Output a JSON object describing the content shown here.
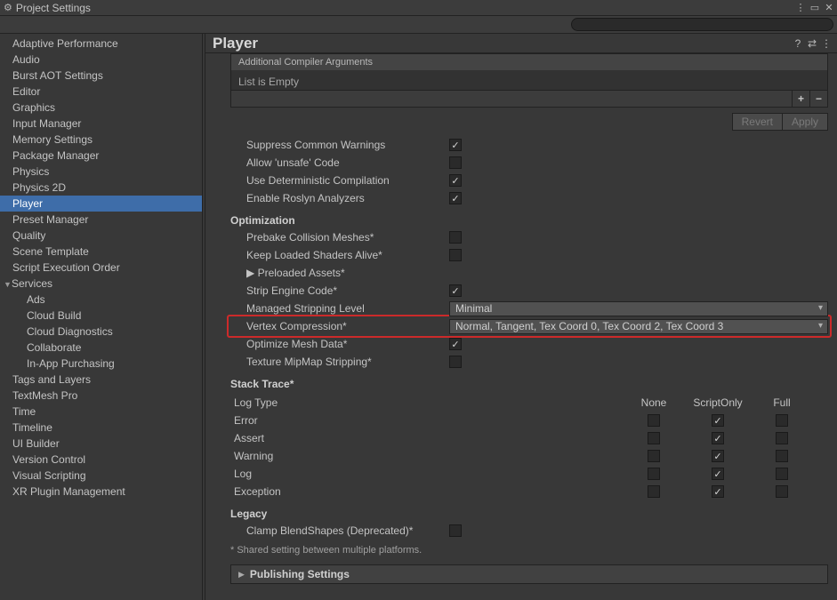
{
  "window": {
    "title": "Project Settings"
  },
  "page": {
    "title": "Player"
  },
  "sidebar": {
    "items": [
      {
        "label": "Adaptive Performance"
      },
      {
        "label": "Audio"
      },
      {
        "label": "Burst AOT Settings"
      },
      {
        "label": "Editor"
      },
      {
        "label": "Graphics"
      },
      {
        "label": "Input Manager"
      },
      {
        "label": "Memory Settings"
      },
      {
        "label": "Package Manager"
      },
      {
        "label": "Physics"
      },
      {
        "label": "Physics 2D"
      },
      {
        "label": "Player",
        "selected": true
      },
      {
        "label": "Preset Manager"
      },
      {
        "label": "Quality"
      },
      {
        "label": "Scene Template"
      },
      {
        "label": "Script Execution Order"
      },
      {
        "label": "Services",
        "expandable": true
      },
      {
        "label": "Ads",
        "sub": true
      },
      {
        "label": "Cloud Build",
        "sub": true
      },
      {
        "label": "Cloud Diagnostics",
        "sub": true
      },
      {
        "label": "Collaborate",
        "sub": true
      },
      {
        "label": "In-App Purchasing",
        "sub": true
      },
      {
        "label": "Tags and Layers"
      },
      {
        "label": "TextMesh Pro"
      },
      {
        "label": "Time"
      },
      {
        "label": "Timeline"
      },
      {
        "label": "UI Builder"
      },
      {
        "label": "Version Control"
      },
      {
        "label": "Visual Scripting"
      },
      {
        "label": "XR Plugin Management"
      }
    ]
  },
  "list": {
    "header": "Additional Compiler Arguments",
    "empty": "List is Empty"
  },
  "buttons": {
    "revert": "Revert",
    "apply": "Apply"
  },
  "props": {
    "suppress": "Suppress Common Warnings",
    "unsafe": "Allow 'unsafe' Code",
    "deterministic": "Use Deterministic Compilation",
    "roslyn": "Enable Roslyn Analyzers"
  },
  "optimization": {
    "header": "Optimization",
    "prebake": "Prebake Collision Meshes*",
    "keepShaders": "Keep Loaded Shaders Alive*",
    "preloaded": "Preloaded Assets*",
    "stripEngine": "Strip Engine Code*",
    "stripping": {
      "label": "Managed Stripping Level",
      "value": "Minimal"
    },
    "vertexComp": {
      "label": "Vertex Compression*",
      "value": "Normal, Tangent, Tex Coord 0, Tex Coord 2, Tex Coord 3"
    },
    "optMesh": "Optimize Mesh Data*",
    "texMip": "Texture MipMap Stripping*"
  },
  "stack": {
    "header": "Stack Trace*",
    "logtype": "Log Type",
    "cols": [
      "None",
      "ScriptOnly",
      "Full"
    ],
    "rows": [
      {
        "label": "Error",
        "vals": [
          false,
          true,
          false
        ]
      },
      {
        "label": "Assert",
        "vals": [
          false,
          true,
          false
        ]
      },
      {
        "label": "Warning",
        "vals": [
          false,
          true,
          false
        ]
      },
      {
        "label": "Log",
        "vals": [
          false,
          true,
          false
        ]
      },
      {
        "label": "Exception",
        "vals": [
          false,
          true,
          false
        ]
      }
    ]
  },
  "legacy": {
    "header": "Legacy",
    "clamp": "Clamp BlendShapes (Deprecated)*"
  },
  "footnote": "* Shared setting between multiple platforms.",
  "foldout": {
    "label": "Publishing Settings"
  }
}
